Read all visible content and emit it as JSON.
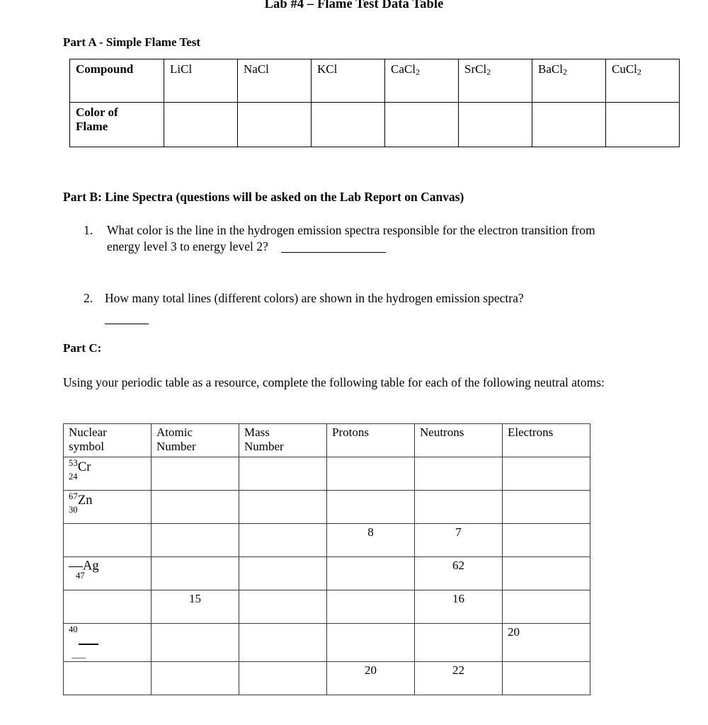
{
  "document": {
    "title": "Lab #4 – Flame Test Data Table"
  },
  "part_a": {
    "heading": "Part A - Simple Flame Test",
    "row_labels": {
      "compound": "Compound",
      "color_of_flame": "Color of Flame"
    },
    "compounds": [
      {
        "formula": "LiCl",
        "base": "LiCl",
        "sub": ""
      },
      {
        "formula": "NaCl",
        "base": "NaCl",
        "sub": ""
      },
      {
        "formula": "KCl",
        "base": "KCl",
        "sub": ""
      },
      {
        "formula": "CaCl2",
        "base": "CaCl",
        "sub": "2"
      },
      {
        "formula": "SrCl2",
        "base": "SrCl",
        "sub": "2"
      },
      {
        "formula": "BaCl2",
        "base": "BaCl",
        "sub": "2"
      },
      {
        "formula": "CuCl2",
        "base": "CuCl",
        "sub": "2"
      }
    ],
    "flame_colors": [
      "",
      "",
      "",
      "",
      "",
      "",
      ""
    ]
  },
  "part_b": {
    "heading": "Part B:  Line Spectra (questions will be asked on the Lab Report on Canvas)",
    "questions": [
      {
        "number": "1.",
        "text": "What color is the line in the hydrogen emission spectra responsible for the electron transition from energy level 3 to energy level 2?",
        "answer": ""
      },
      {
        "number": "2.",
        "text": "How many total lines (different colors) are shown in the hydrogen emission spectra?",
        "answer": ""
      }
    ]
  },
  "part_c": {
    "heading": "Part C:",
    "intro": "Using your periodic table as a resource, complete the following table for each of the following neutral atoms:",
    "columns": [
      "Nuclear symbol",
      "Atomic Number",
      "Mass Number",
      "Protons",
      "Neutrons",
      "Electrons"
    ],
    "rows": [
      {
        "nuclear_symbol": {
          "mass": "53",
          "symbol": "Cr",
          "atomic": "24",
          "style": "isotope"
        },
        "atomic_number": "",
        "mass_number": "",
        "protons": "",
        "neutrons": "",
        "electrons": ""
      },
      {
        "nuclear_symbol": {
          "mass": "67",
          "symbol": "Zn",
          "atomic": "30",
          "style": "isotope"
        },
        "atomic_number": "",
        "mass_number": "",
        "protons": "",
        "neutrons": "",
        "electrons": ""
      },
      {
        "nuclear_symbol": {
          "mass": "",
          "symbol": "",
          "atomic": "",
          "style": "empty"
        },
        "atomic_number": "",
        "mass_number": "",
        "protons": "8",
        "neutrons": "7",
        "electrons": ""
      },
      {
        "nuclear_symbol": {
          "mass": "—",
          "symbol": "Ag",
          "atomic": "47",
          "style": "dash-mass"
        },
        "atomic_number": "",
        "mass_number": "",
        "protons": "",
        "neutrons": "62",
        "electrons": ""
      },
      {
        "nuclear_symbol": {
          "mass": "",
          "symbol": "",
          "atomic": "",
          "style": "empty"
        },
        "atomic_number": "15",
        "mass_number": "",
        "protons": "",
        "neutrons": "16",
        "electrons": ""
      },
      {
        "nuclear_symbol": {
          "mass": "40",
          "symbol": "—",
          "atomic": "—",
          "style": "blank-symbol"
        },
        "atomic_number": "",
        "mass_number": "",
        "protons": "",
        "neutrons": "",
        "electrons": "20"
      },
      {
        "nuclear_symbol": {
          "mass": "",
          "symbol": "",
          "atomic": "",
          "style": "empty"
        },
        "atomic_number": "",
        "mass_number": "",
        "protons": "20",
        "neutrons": "22",
        "electrons": ""
      }
    ]
  }
}
